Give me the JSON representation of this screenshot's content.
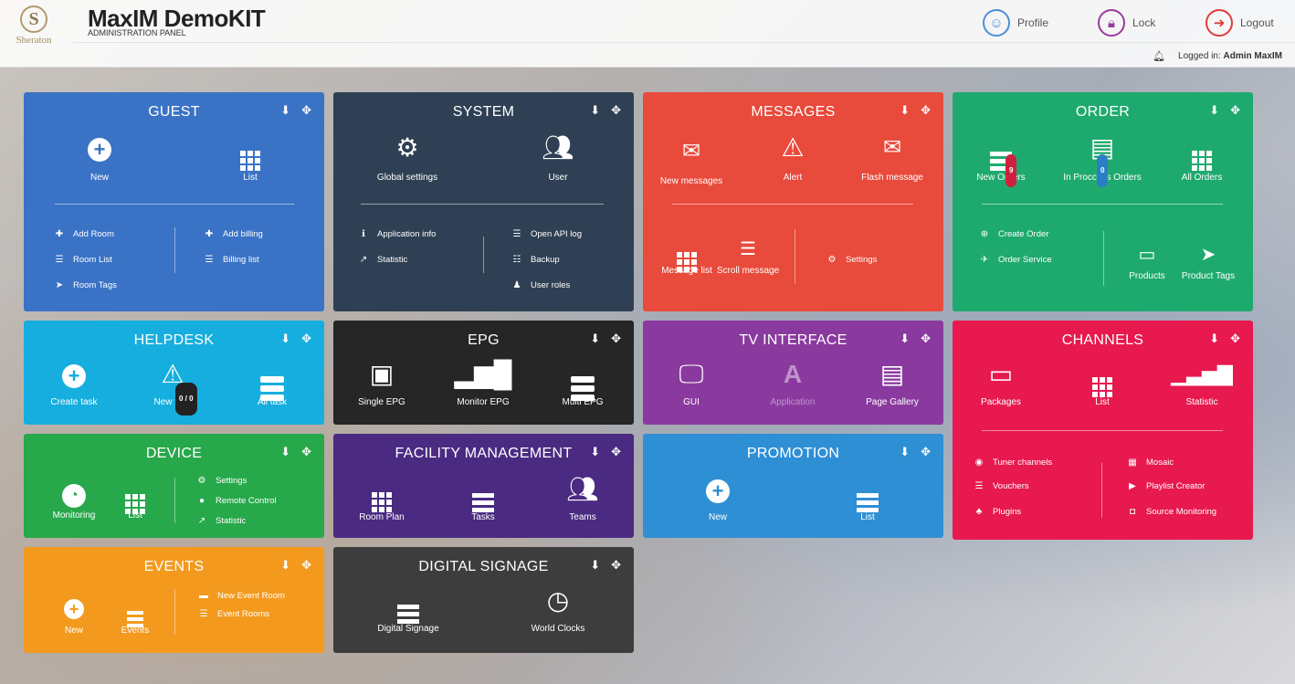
{
  "header": {
    "logo_letter": "S",
    "brand": "Sheraton",
    "title": "MaxIM DemoKIT",
    "subtitle": "ADMINISTRATION PANEL",
    "profile": "Profile",
    "lock": "Lock",
    "logout": "Logout",
    "logged_prefix": "Logged in:",
    "logged_user": "Admin MaxIM"
  },
  "tiles": {
    "guest": {
      "title": "GUEST",
      "color": "#3a73c6",
      "new": "New",
      "list": "List",
      "links": [
        "Add Room",
        "Room List",
        "Room Tags",
        "Add billing",
        "Billing list"
      ]
    },
    "system": {
      "title": "SYSTEM",
      "color": "#2f4054",
      "global": "Global settings",
      "user": "User",
      "links": [
        "Application info",
        "Statistic",
        "Open API log",
        "Backup",
        "User roles"
      ]
    },
    "messages": {
      "title": "MESSAGES",
      "color": "#e84a3b",
      "new": "New messages",
      "alert": "Alert",
      "flash": "Flash message",
      "list": "Message list",
      "scroll": "Scroll message",
      "settings": "Settings"
    },
    "order": {
      "title": "ORDER",
      "color": "#1eaa6e",
      "new": "New Orders",
      "new_count": "9",
      "process": "In Proccess Orders",
      "process_count": "0",
      "all": "All Orders",
      "links": [
        "Create Order",
        "Order Service"
      ],
      "products": "Products",
      "tags": "Product Tags"
    },
    "helpdesk": {
      "title": "HELPDESK",
      "color": "#16aede",
      "create": "Create task",
      "new": "New task",
      "new_count": "0 / 0",
      "all": "All task"
    },
    "epg": {
      "title": "EPG",
      "color": "#262626",
      "single": "Single EPG",
      "monitor": "Monitor EPG",
      "multi": "Multi EPG"
    },
    "tv": {
      "title": "TV INTERFACE",
      "color": "#8a3a9e",
      "gui": "GUI",
      "app": "Application",
      "gallery": "Page Gallery"
    },
    "channels": {
      "title": "CHANNELS",
      "color": "#e7194e",
      "packages": "Packages",
      "list": "List",
      "statistic": "Statistic",
      "links": [
        "Tuner channels",
        "Vouchers",
        "Plugins",
        "Mosaic",
        "Playlist Creator",
        "Source Monitoring"
      ]
    },
    "device": {
      "title": "DEVICE",
      "color": "#27a84a",
      "monitoring": "Monitoring",
      "list": "List",
      "links": [
        "Settings",
        "Remote Control",
        "Statistic"
      ]
    },
    "facility": {
      "title": "FACILITY MANAGEMENT",
      "color": "#4b2a82",
      "room": "Room Plan",
      "tasks": "Tasks",
      "teams": "Teams"
    },
    "promotion": {
      "title": "PROMOTION",
      "color": "#2f8fd4",
      "new": "New",
      "list": "List"
    },
    "events": {
      "title": "EVENTS",
      "color": "#f39a1e",
      "new": "New",
      "events": "Events",
      "links": [
        "New Event Room",
        "Event Rooms"
      ]
    },
    "signage": {
      "title": "DIGITAL SIGNAGE",
      "color": "#3d3d3d",
      "digital": "Digital Signage",
      "clocks": "World Clocks"
    }
  }
}
